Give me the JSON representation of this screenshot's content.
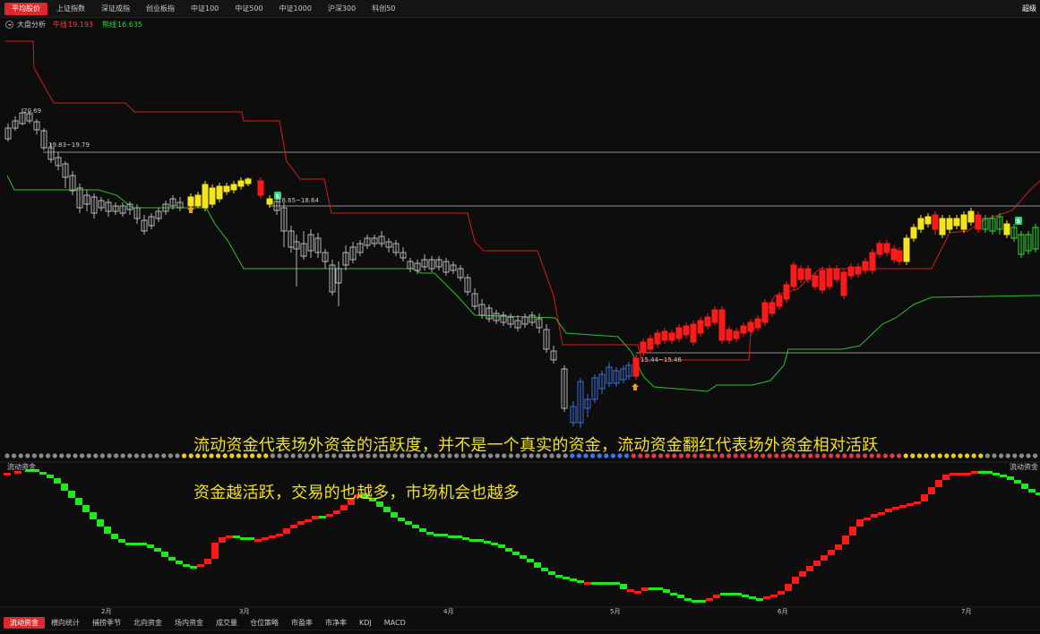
{
  "top_tabs": [
    {
      "label": "平均股价",
      "active": true
    },
    {
      "label": "上证指数",
      "active": false
    },
    {
      "label": "深证成指",
      "active": false
    },
    {
      "label": "创业板指",
      "active": false
    },
    {
      "label": "中证100",
      "active": false
    },
    {
      "label": "中证500",
      "active": false
    },
    {
      "label": "中证1000",
      "active": false
    },
    {
      "label": "沪深300",
      "active": false
    },
    {
      "label": "科创50",
      "active": false
    }
  ],
  "top_right_label": "超级",
  "indicator": {
    "name": "大盘分析",
    "bull_label": "牛线",
    "bull_value": "19.193",
    "bear_label": "熊线",
    "bear_value": "16.635"
  },
  "price_annotations": {
    "high": "20.69",
    "level_1": "19.83~19.79",
    "level_2": "18.65~18.64",
    "level_3": "15.44~15.46"
  },
  "month_labels": [
    "2月",
    "3月",
    "4月",
    "5月",
    "6月",
    "7月"
  ],
  "captions": [
    "流动资金代表场外资金的活跃度，并不是一个真实的资金，流动资金翻红代表场外资金相对活跃",
    "资金越活跃，交易的也越多，市场机会也越多"
  ],
  "lower_panel": {
    "title": "流动资金",
    "title_right": "流动资金"
  },
  "bottom_tabs": [
    {
      "label": "流动资金",
      "active": true
    },
    {
      "label": "横向统计",
      "active": false
    },
    {
      "label": "捕捞季节",
      "active": false
    },
    {
      "label": "北向资金",
      "active": false
    },
    {
      "label": "场内资金",
      "active": false
    },
    {
      "label": "成交量",
      "active": false
    },
    {
      "label": "仓位策略",
      "active": false
    },
    {
      "label": "市盈率",
      "active": false
    },
    {
      "label": "市净率",
      "active": false
    },
    {
      "label": "KDJ",
      "active": false
    },
    {
      "label": "MACD",
      "active": false
    }
  ],
  "colors": {
    "background": "#0d0d0d",
    "accent": "#e0282b",
    "bull": "#ff1a1a",
    "bear": "#33cc33",
    "neutral_candle": "#b4b4b4",
    "highlight_candle": "#f5e51e",
    "cold_candle": "#3a6fd8",
    "caption": "#f2e024",
    "money_up": "#ff1a1a",
    "money_down": "#1fe81f"
  }
}
